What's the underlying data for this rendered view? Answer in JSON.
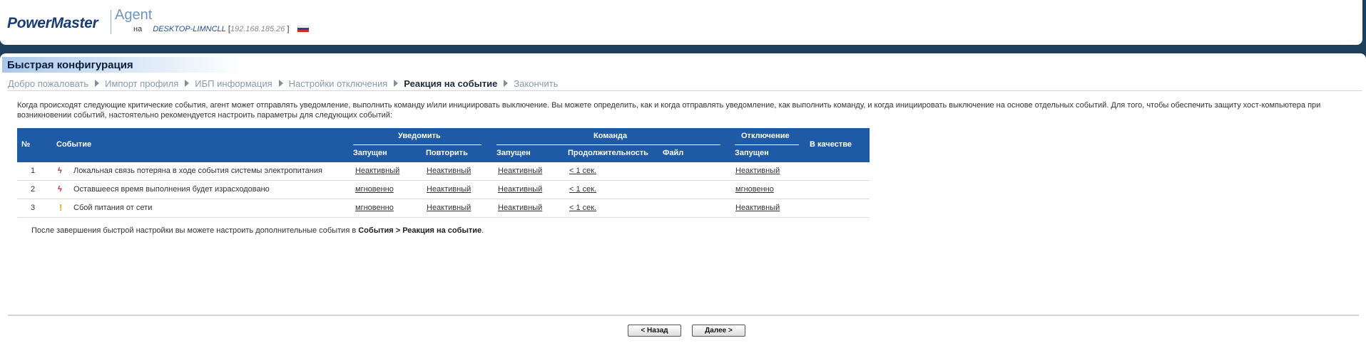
{
  "header": {
    "logo": "PowerMaster",
    "title": "Agent",
    "on_label": "на",
    "host": "DESKTOP-LIMNCLL",
    "ip_open": "[",
    "ip": "192.168.185.26",
    "ip_close": "]",
    "flag": "russia-flag-icon"
  },
  "section_title": "Быстрая конфигурация",
  "breadcrumb": [
    {
      "label": "Добро пожаловать"
    },
    {
      "label": "Импорт профиля"
    },
    {
      "label": "ИБП информация"
    },
    {
      "label": "Настройки отключения"
    },
    {
      "label": "Реакция на событие"
    },
    {
      "label": "Закончить"
    }
  ],
  "intro": "Когда происходят следующие критические события, агент может отправлять уведомление, выполнить команду и/или инициировать выключение. Вы можете определить, как и когда отправлять уведомление, как выполнить команду, и когда инициировать выключение на основе отдельных событий. Для того, чтобы обеспечить защиту хост-компьютера при возникновении событий, настоятельно рекомендуется настроить параметры для следующих событий:",
  "table": {
    "headers": {
      "num": "№",
      "event": "Событие",
      "notify": "Уведомить",
      "command": "Команда",
      "shutdown": "Отключение",
      "as": "В качестве",
      "notify_started": "Запущен",
      "notify_repeat": "Повторить",
      "cmd_started": "Запущен",
      "cmd_duration": "Продолжительность",
      "cmd_file": "Файл",
      "shut_started": "Запущен"
    },
    "rows": [
      {
        "num": "1",
        "icon": "lightning-icon",
        "icon_glyph": "ϟ",
        "event": "Локальная связь потеряна в ходе события системы электропитания",
        "notify_started": "Неактивный",
        "notify_repeat": "Неактивный",
        "cmd_started": "Неактивный",
        "cmd_duration": "< 1 сек.",
        "shut_started": "Неактивный"
      },
      {
        "num": "2",
        "icon": "lightning-icon",
        "icon_glyph": "ϟ",
        "event": "Оставшееся время выполнения будет израсходовано",
        "notify_started": "мгновенно",
        "notify_repeat": "Неактивный",
        "cmd_started": "Неактивный",
        "cmd_duration": "< 1 сек.",
        "shut_started": "мгновенно"
      },
      {
        "num": "3",
        "icon": "warning-icon",
        "icon_glyph": "!",
        "event": "Сбой питания от сети",
        "notify_started": "мгновенно",
        "notify_repeat": "Неактивный",
        "cmd_started": "Неактивный",
        "cmd_duration": "< 1 сек.",
        "shut_started": "Неактивный"
      }
    ]
  },
  "after_text": {
    "prefix": "После завершения быстрой настройки вы можете настроить дополнительные события в ",
    "bold": "События > Реакция на событие",
    "suffix": "."
  },
  "buttons": {
    "back": "< Назад",
    "next": "Далее >"
  },
  "colors": {
    "header_bg": "#1e5aa5",
    "frame": "#1e3f5c",
    "logo": "#1b3c73"
  }
}
